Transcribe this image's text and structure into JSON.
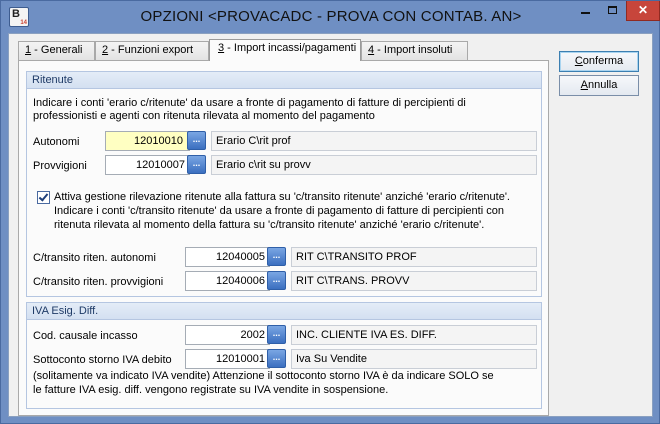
{
  "window": {
    "title": "OPZIONI <PROVACADC - PROVA CON CONTAB. AN>",
    "icon_letter": "B",
    "icon_number": "14",
    "controls": {
      "minimize": "minimize-icon",
      "maximize": "maximize-icon",
      "close": "✕"
    }
  },
  "tabs": [
    {
      "num": "1",
      "label": " - Generali"
    },
    {
      "num": "2",
      "label": " - Funzioni export"
    },
    {
      "num": "3",
      "label": " - Import incassi/pagamenti"
    },
    {
      "num": "4",
      "label": " - Import insoluti"
    }
  ],
  "active_tab": 2,
  "ritenute": {
    "header": "Ritenute",
    "intro_line1": "Indicare i conti 'erario c/ritenute' da usare a fronte di pagamento di fatture di percipienti di",
    "intro_line2": "professionisti e agenti con ritenuta rilevata al momento del pagamento",
    "autonomi": {
      "label": "Autonomi",
      "code": "12010010",
      "description": "Erario C\\rit prof"
    },
    "provvigioni": {
      "label": "Provvigioni",
      "code": "12010007",
      "description": "Erario c\\rit su provv"
    },
    "transito_checkbox": {
      "checked": true,
      "line1": "Attiva gestione rilevazione ritenute alla fattura su 'c/transito ritenute' anziché 'erario c/ritenute'.",
      "line2": "Indicare i conti 'c/transito ritenute' da usare a fronte di pagamento di fatture di percipienti con",
      "line3": "ritenuta rilevata al momento della fattura su  'c/transito ritenute' anziché 'erario c/ritenute'."
    },
    "transito_autonomi": {
      "label": "C/transito riten. autonomi",
      "code": "12040005",
      "description": "RIT C\\TRANSITO PROF"
    },
    "transito_provvigioni": {
      "label": "C/transito riten. provvigioni",
      "code": "12040006",
      "description": "RIT C\\TRANS. PROVV"
    }
  },
  "iva": {
    "header": "IVA Esig. Diff.",
    "causale": {
      "label": "Cod. causale incasso",
      "code": "2002",
      "description": "INC. CLIENTE IVA ES. DIFF."
    },
    "storno": {
      "label": "Sottoconto storno IVA debito",
      "code": "12010001",
      "description": "Iva Su Vendite"
    },
    "note_line1": "(solitamente va indicato IVA vendite) Attenzione il sottoconto storno IVA è da indicare SOLO se",
    "note_line2": "le fatture IVA esig. diff. vengono registrate su IVA vendite in sospensione."
  },
  "buttons": {
    "confirm": {
      "mnemonic": "C",
      "rest": "onferma"
    },
    "cancel": {
      "mnemonic": "A",
      "rest": "nnulla"
    },
    "browse_glyph": "..."
  }
}
